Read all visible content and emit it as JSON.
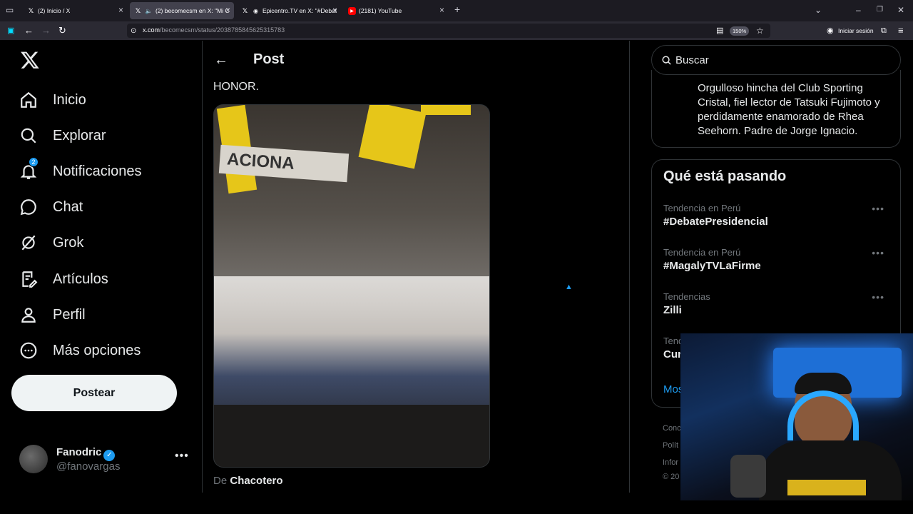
{
  "browser": {
    "tabs": [
      {
        "title": "(2) Inicio / X",
        "favicon": "x-logo",
        "active": false
      },
      {
        "title": "(2) becomecsm en X: \"Mi C",
        "favicon": "x-logo",
        "active": true
      },
      {
        "title": "Epicentro.TV en X: \"#Debat",
        "favicon": "x-logo",
        "active": false
      },
      {
        "title": "(2181) YouTube",
        "favicon": "youtube-icon",
        "active": false
      }
    ],
    "url_domain": "x.com",
    "url_path": "/becomecsm/status/2038785845625315783",
    "zoom": "150%",
    "signin_label": "Iniciar sesión"
  },
  "sidebar": {
    "items": [
      {
        "label": "Inicio",
        "icon": "home-icon"
      },
      {
        "label": "Explorar",
        "icon": "search-icon"
      },
      {
        "label": "Notificaciones",
        "icon": "bell-icon",
        "badge": "2"
      },
      {
        "label": "Chat",
        "icon": "chat-bubble-icon"
      },
      {
        "label": "Grok",
        "icon": "grok-icon"
      },
      {
        "label": "Artículos",
        "icon": "article-icon"
      },
      {
        "label": "Perfil",
        "icon": "person-icon"
      },
      {
        "label": "Más opciones",
        "icon": "more-circle-icon"
      }
    ],
    "post_button": "Postear",
    "profile": {
      "name": "Fanodric",
      "handle": "@fanovargas"
    }
  },
  "main": {
    "heading": "Post",
    "post_text": "HONOR.",
    "media_banner_text": "ACIONA",
    "source_prefix": "De",
    "source_name": "Chacotero"
  },
  "right": {
    "search_placeholder": "Buscar",
    "bio": "Orgulloso hincha del Club Sporting Cristal, fiel lector de Tatsuki Fujimoto y perdidamente enamorado de Rhea Seehorn. Padre de Jorge Ignacio.",
    "trends_title": "Qué está pasando",
    "trends": [
      {
        "context": "Tendencia en Perú",
        "name": "#DebatePresidencial"
      },
      {
        "context": "Tendencia en Perú",
        "name": "#MagalyTVLaFirme"
      },
      {
        "context": "Tendencias",
        "name": "Zilli"
      },
      {
        "context": "Tend",
        "name": "Cur"
      }
    ],
    "show_more": "Mos",
    "footer": [
      "Conc",
      "Polít",
      "Infor",
      "© 20"
    ]
  },
  "colors": {
    "accent": "#1d9bf0",
    "background": "#000000",
    "border": "#2f3336",
    "muted": "#71767b"
  }
}
